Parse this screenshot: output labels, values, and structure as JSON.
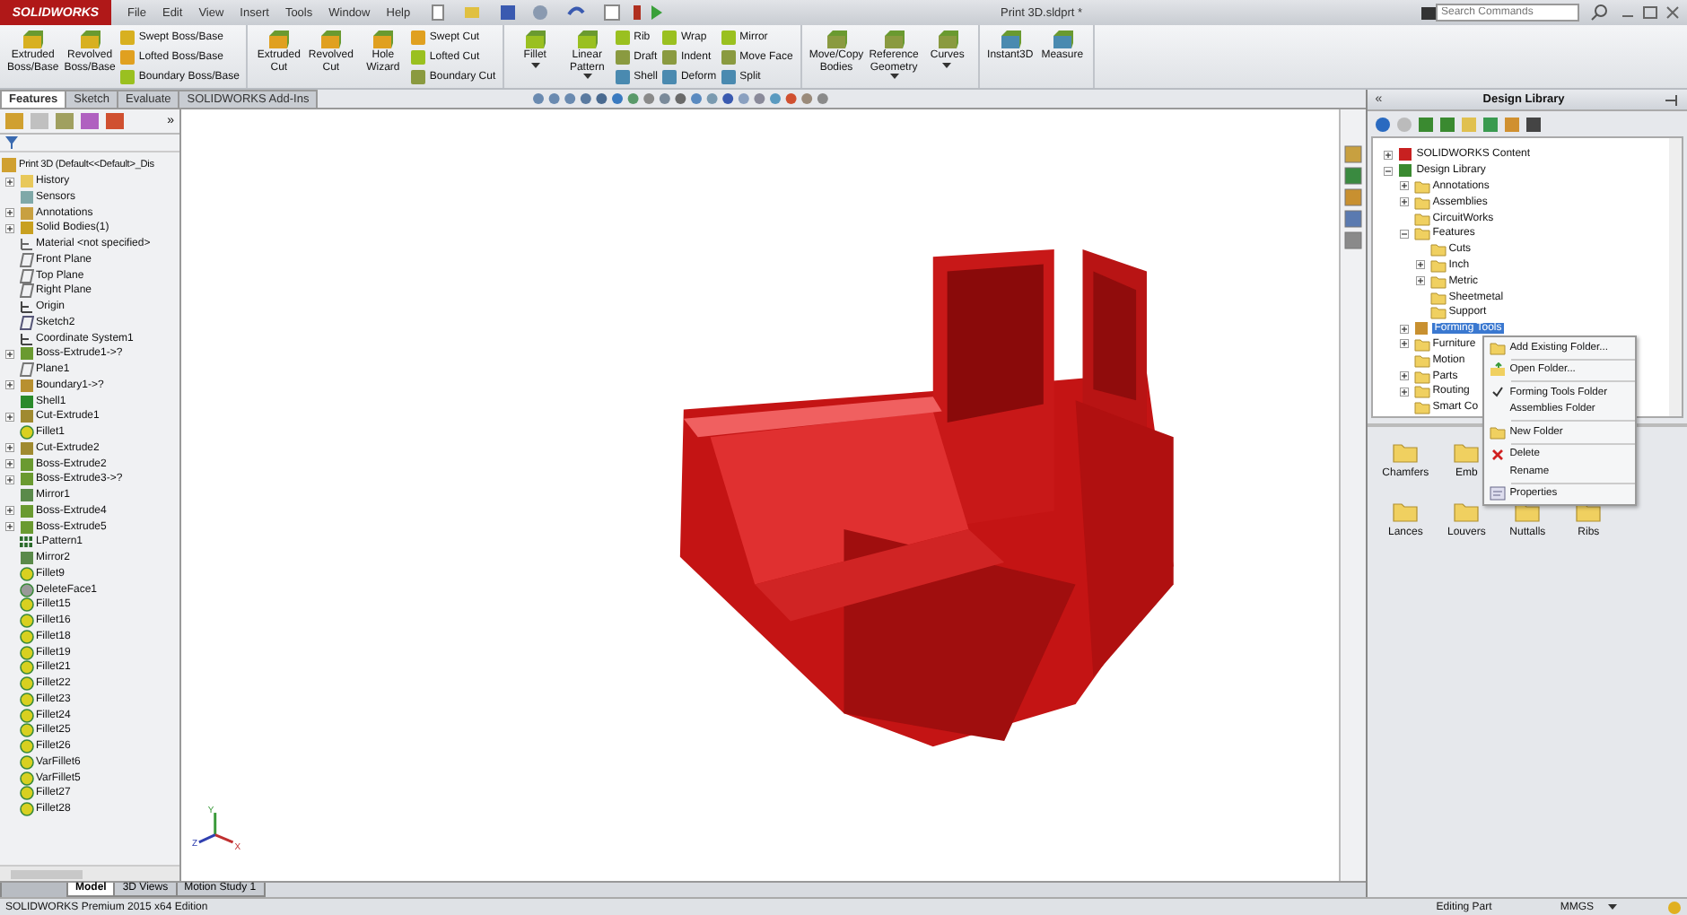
{
  "app": {
    "logo": "SOLIDWORKS",
    "menus": [
      "File",
      "Edit",
      "View",
      "Insert",
      "Tools",
      "Window",
      "Help"
    ],
    "title": "Print 3D.sldprt *",
    "search": {
      "placeholder": "Search Commands"
    }
  },
  "ribbon": {
    "groups": [
      {
        "items": [
          {
            "kind": "large",
            "label": "Extruded\nBoss/Base",
            "dropdown": false
          },
          {
            "kind": "large",
            "label": "Revolved\nBoss/Base",
            "dropdown": false
          },
          {
            "kind": "stack",
            "labels": [
              "Swept Boss/Base",
              "Lofted Boss/Base",
              "Boundary Boss/Base"
            ]
          }
        ]
      },
      {
        "items": [
          {
            "kind": "large",
            "label": "Extruded\nCut",
            "dropdown": false
          },
          {
            "kind": "large",
            "label": "Revolved\nCut",
            "dropdown": false
          },
          {
            "kind": "large",
            "label": "Hole\nWizard",
            "dropdown": false
          },
          {
            "kind": "stack",
            "labels": [
              "Swept Cut",
              "Lofted Cut",
              "Boundary Cut"
            ]
          }
        ]
      },
      {
        "items": [
          {
            "kind": "large",
            "label": "Fillet",
            "dropdown": true
          },
          {
            "kind": "large",
            "label": "Linear\nPattern",
            "dropdown": true
          },
          {
            "kind": "stack",
            "labels": [
              "Rib",
              "Draft",
              "Shell"
            ]
          },
          {
            "kind": "stack",
            "labels": [
              "Wrap",
              "Indent",
              "Deform"
            ]
          },
          {
            "kind": "stack",
            "labels": [
              "Mirror",
              "Move Face",
              "Split"
            ]
          }
        ]
      },
      {
        "items": [
          {
            "kind": "large",
            "label": "Move/Copy\nBodies",
            "dropdown": false
          },
          {
            "kind": "large",
            "label": "Reference\nGeometry",
            "dropdown": true
          },
          {
            "kind": "large",
            "label": "Curves",
            "dropdown": true
          }
        ]
      },
      {
        "items": [
          {
            "kind": "large",
            "label": "Instant3D",
            "dropdown": false
          },
          {
            "kind": "large",
            "label": "Measure",
            "dropdown": false
          }
        ]
      }
    ]
  },
  "command_tabs": [
    {
      "label": "Features",
      "selected": true
    },
    {
      "label": "Sketch",
      "selected": false
    },
    {
      "label": "Evaluate",
      "selected": false
    },
    {
      "label": "SOLIDWORKS Add-Ins",
      "selected": false
    }
  ],
  "feature_tree": {
    "more": "»",
    "root": "Print 3D  (Default<<Default>_Dis",
    "items": [
      {
        "label": "History",
        "kind": "folder",
        "expanded": false
      },
      {
        "label": "Sensors",
        "kind": "sensor"
      },
      {
        "label": "Annotations",
        "kind": "annotation",
        "expanded": false
      },
      {
        "label": "Solid Bodies(1)",
        "kind": "solid",
        "expanded": false
      },
      {
        "label": "Material <not specified>",
        "kind": "material"
      },
      {
        "label": "Front Plane",
        "kind": "plane"
      },
      {
        "label": "Top Plane",
        "kind": "plane"
      },
      {
        "label": "Right Plane",
        "kind": "plane"
      },
      {
        "label": "Origin",
        "kind": "origin"
      },
      {
        "label": "Sketch2",
        "kind": "sketch"
      },
      {
        "label": "Coordinate System1",
        "kind": "origin"
      },
      {
        "label": "Boss-Extrude1->?",
        "kind": "extrude",
        "expanded": false
      },
      {
        "label": "Plane1",
        "kind": "plane"
      },
      {
        "label": "Boundary1->?",
        "kind": "boundary",
        "expanded": false
      },
      {
        "label": "Shell1",
        "kind": "shell"
      },
      {
        "label": "Cut-Extrude1",
        "kind": "cut",
        "expanded": false
      },
      {
        "label": "Fillet1",
        "kind": "fillet"
      },
      {
        "label": "Cut-Extrude2",
        "kind": "cut",
        "expanded": false
      },
      {
        "label": "Boss-Extrude2",
        "kind": "extrude",
        "expanded": false
      },
      {
        "label": "Boss-Extrude3->?",
        "kind": "extrude",
        "expanded": false
      },
      {
        "label": "Mirror1",
        "kind": "mirror"
      },
      {
        "label": "Boss-Extrude4",
        "kind": "extrude",
        "expanded": false
      },
      {
        "label": "Boss-Extrude5",
        "kind": "extrude",
        "expanded": false
      },
      {
        "label": "LPattern1",
        "kind": "pattern"
      },
      {
        "label": "Mirror2",
        "kind": "mirror"
      },
      {
        "label": "Fillet9",
        "kind": "fillet"
      },
      {
        "label": "DeleteFace1",
        "kind": "delete"
      },
      {
        "label": "Fillet15",
        "kind": "fillet"
      },
      {
        "label": "Fillet16",
        "kind": "fillet"
      },
      {
        "label": "Fillet18",
        "kind": "fillet"
      },
      {
        "label": "Fillet19",
        "kind": "fillet"
      },
      {
        "label": "Fillet21",
        "kind": "fillet"
      },
      {
        "label": "Fillet22",
        "kind": "fillet"
      },
      {
        "label": "Fillet23",
        "kind": "fillet"
      },
      {
        "label": "Fillet24",
        "kind": "fillet"
      },
      {
        "label": "Fillet25",
        "kind": "fillet"
      },
      {
        "label": "Fillet26",
        "kind": "fillet"
      },
      {
        "label": "VarFillet6",
        "kind": "fillet"
      },
      {
        "label": "VarFillet5",
        "kind": "fillet"
      },
      {
        "label": "Fillet27",
        "kind": "fillet"
      },
      {
        "label": "Fillet28",
        "kind": "fillet"
      }
    ]
  },
  "viewport": {
    "triad": {
      "x": "X",
      "y": "Y",
      "z": "Z"
    }
  },
  "design_library": {
    "collapse": "«",
    "title": "Design Library",
    "tree": [
      {
        "label": "SOLIDWORKS Content",
        "kind": "content",
        "expanded": false,
        "selected": false
      },
      {
        "label": "Design Library",
        "kind": "library",
        "expanded": true,
        "selected": false,
        "children": [
          {
            "label": "Annotations",
            "kind": "folder",
            "expanded": false,
            "selected": false
          },
          {
            "label": "Assemblies",
            "kind": "folder",
            "expanded": false,
            "selected": false
          },
          {
            "label": "CircuitWorks",
            "kind": "folder",
            "selected": false
          },
          {
            "label": "Features",
            "kind": "folder",
            "expanded": true,
            "selected": false,
            "children": [
              {
                "label": "Cuts",
                "kind": "folder",
                "selected": false
              },
              {
                "label": "Inch",
                "kind": "folder",
                "expanded": false,
                "selected": false
              },
              {
                "label": "Metric",
                "kind": "folder",
                "expanded": false,
                "selected": false
              },
              {
                "label": "Sheetmetal",
                "kind": "folder",
                "selected": false
              },
              {
                "label": "Support",
                "kind": "folder",
                "selected": false
              }
            ]
          },
          {
            "label": "Forming Tools",
            "kind": "forming",
            "expanded": false,
            "selected": true
          },
          {
            "label": "Furniture",
            "kind": "folder",
            "expanded": false,
            "selected": false
          },
          {
            "label": "Motion",
            "kind": "folder",
            "selected": false
          },
          {
            "label": "Parts",
            "kind": "folder",
            "expanded": false,
            "selected": false
          },
          {
            "label": "Routing",
            "kind": "folder",
            "expanded": false,
            "selected": false
          },
          {
            "label": "Smart Co",
            "kind": "folder",
            "selected": false
          }
        ]
      }
    ],
    "palette": [
      [
        "Chamfers",
        "Emb"
      ],
      [
        "Lances",
        "Louvers",
        "Nuttalls",
        "Ribs"
      ]
    ],
    "context_menu": {
      "groups": [
        [
          {
            "label": "Add Existing Folder...",
            "kind": "folder",
            "checked": false
          }
        ],
        [
          {
            "label": "Open Folder...",
            "kind": "open",
            "checked": false
          }
        ],
        [
          {
            "label": "Forming Tools Folder",
            "kind": "plain",
            "checked": true
          },
          {
            "label": "Assemblies Folder",
            "kind": "plain",
            "checked": false
          }
        ],
        [
          {
            "label": "New Folder",
            "kind": "folder",
            "checked": false
          }
        ],
        [
          {
            "label": "Delete",
            "kind": "delete",
            "checked": false
          },
          {
            "label": "Rename",
            "kind": "plain",
            "checked": false
          }
        ],
        [
          {
            "label": "Properties",
            "kind": "properties",
            "checked": false
          }
        ]
      ]
    }
  },
  "bottom_tabs": [
    {
      "label": "Model",
      "selected": true
    },
    {
      "label": "3D Views",
      "selected": false
    },
    {
      "label": "Motion Study 1",
      "selected": false
    }
  ],
  "status_bar": {
    "edition": "SOLIDWORKS Premium 2015 x64 Edition",
    "mode": "Editing Part",
    "units": "MMGS"
  }
}
